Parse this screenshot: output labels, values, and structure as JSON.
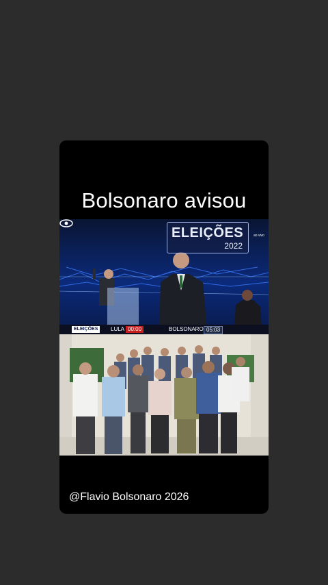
{
  "post": {
    "title": "Bolsonaro avisou",
    "handle": "@Flavio Bolsonaro 2026"
  },
  "debate_frame": {
    "logo_title": "ELEIÇÕES",
    "logo_year": "2022",
    "live_label": "ao vivo",
    "lower_tag": "ELEIÇÕES",
    "candidate_1": "LULA",
    "timer_1": "00:00",
    "candidate_2": "BOLSONARO",
    "timer_2": "05:03"
  },
  "colors": {
    "background": "#2c2c2c",
    "card": "#000000",
    "timer_red": "#c41e1e"
  }
}
